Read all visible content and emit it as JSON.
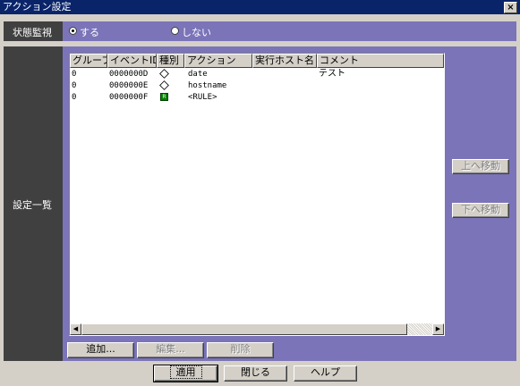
{
  "window": {
    "title": "アクション設定",
    "close_glyph": "×"
  },
  "status_monitoring": {
    "label": "状態監視",
    "options": [
      {
        "label": "する",
        "selected": true
      },
      {
        "label": "しない",
        "selected": false
      }
    ]
  },
  "settings_list": {
    "label": "設定一覧",
    "columns": [
      "グループ",
      "イベントID",
      "種別",
      "アクション",
      "実行ホスト名",
      "コメント"
    ],
    "rows": [
      {
        "group": "0",
        "event_id": "0000000D",
        "type_icon": "command-icon",
        "action": "date",
        "host": "",
        "comment": "テスト"
      },
      {
        "group": "0",
        "event_id": "0000000E",
        "type_icon": "command-icon",
        "action": "hostname",
        "host": "",
        "comment": ""
      },
      {
        "group": "0",
        "event_id": "0000000F",
        "type_icon": "rule-icon",
        "action": "<RULE>",
        "host": "",
        "comment": ""
      }
    ],
    "move_up_label": "上へ移動",
    "move_down_label": "下へ移動"
  },
  "list_buttons": {
    "add": "追加...",
    "edit": "編集...",
    "delete": "削除"
  },
  "footer_buttons": {
    "apply": "適用",
    "close": "閉じる",
    "help": "ヘルプ"
  },
  "colors": {
    "title_bar": "#0a246a",
    "panel": "#7b74b8",
    "label_panel": "#404040",
    "face": "#d4d0c8"
  }
}
